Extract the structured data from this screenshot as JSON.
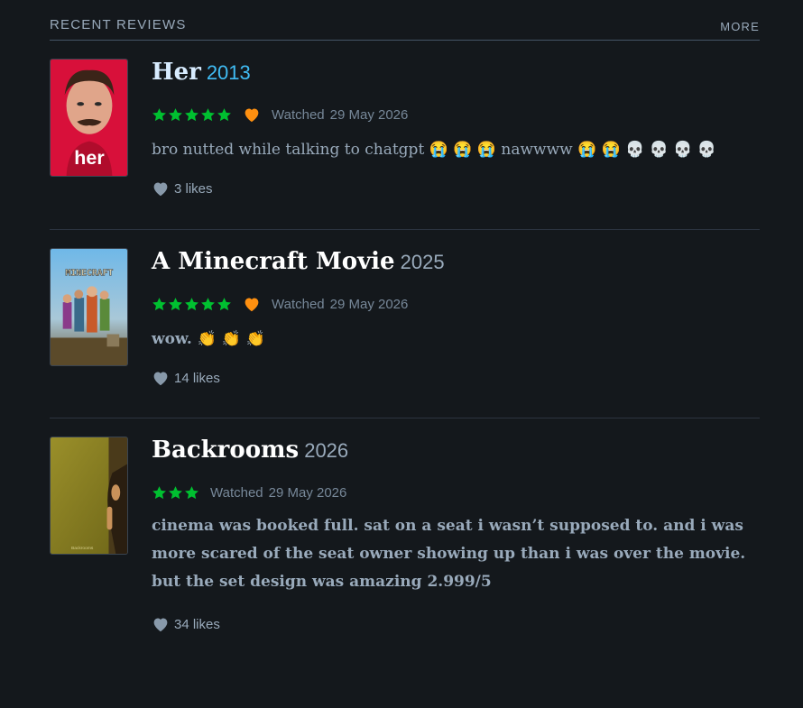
{
  "section": {
    "title": "RECENT REVIEWS",
    "more_label": "MORE"
  },
  "colors": {
    "background": "#14181c",
    "star_green": "#00c030",
    "heart_orange": "#ff9010",
    "muted_text": "#99aabb",
    "year_highlight": "#40bcf4"
  },
  "reviews": [
    {
      "title": "Her",
      "year": "2013",
      "rating": 5,
      "liked": true,
      "watched_label": "Watched",
      "date": "29 May 2026",
      "text": "bro nutted while talking to chatgpt 😭 😭 😭  nawwww 😭 😭 💀 💀 💀 💀",
      "likes": "3 likes",
      "poster_text": "her"
    },
    {
      "title": "A Minecraft Movie",
      "year": "2025",
      "rating": 5,
      "liked": true,
      "watched_label": "Watched",
      "date": "29 May 2026",
      "text": "wow. 👏 👏 👏",
      "likes": "14 likes",
      "poster_text": "MINECRAFT"
    },
    {
      "title": "Backrooms",
      "year": "2026",
      "rating": 3,
      "liked": false,
      "watched_label": "Watched",
      "date": "29 May 2026",
      "text": "cinema was booked full. sat on a seat i wasn’t supposed to. and i was more scared of the seat owner showing up than i was over the movie. but the set design was amazing 2.999/5",
      "likes": "34 likes",
      "poster_text": "Backrooms"
    }
  ]
}
